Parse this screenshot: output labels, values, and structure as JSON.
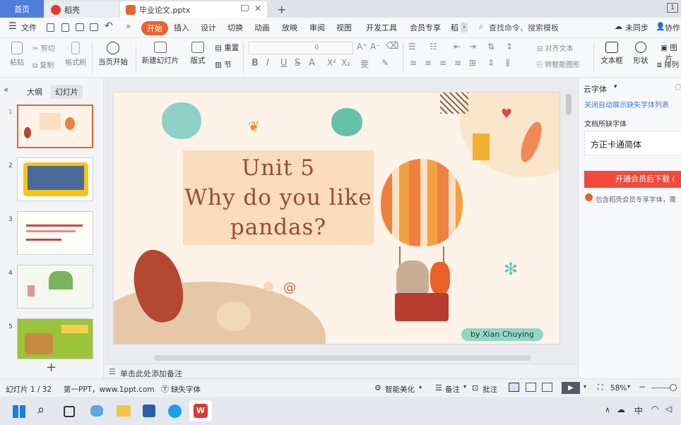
{
  "tabs": {
    "home": "首页",
    "docer": "稻壳",
    "file": "毕业论文.pptx",
    "add": "+"
  },
  "menu": {
    "file": "文件",
    "items": [
      "开始",
      "插入",
      "设计",
      "切换",
      "动画",
      "放映",
      "审阅",
      "视图",
      "开发工具",
      "会员专享",
      "稻"
    ],
    "search": "查找命令、搜索模板",
    "sync": "未同步",
    "collab": "协作"
  },
  "ribbon": {
    "paste": "粘贴",
    "cut": "剪切",
    "copy": "复制",
    "format_painter": "格式刷",
    "from_start": "当页开始",
    "new_slide": "新建幻灯片",
    "layout": "版式",
    "reset": "重置",
    "section": "节",
    "font_size": "0",
    "align_text": "对齐文本",
    "smart_art": "转智能图形",
    "textbox": "文本框",
    "shape": "形状",
    "picture": "图片",
    "arrange": "排列"
  },
  "leftpanel": {
    "outline_tab": "大纲",
    "slides_tab": "幻灯片",
    "numbers": [
      "1",
      "2",
      "3",
      "4",
      "5"
    ],
    "add": "+"
  },
  "slide": {
    "title_line1": "Unit 5",
    "title_line2": "Why do you like",
    "title_line3": "pandas?",
    "byline": "by Xian Chuying"
  },
  "notes": {
    "placeholder": "单击此处添加备注"
  },
  "rightpanel": {
    "cloud_font": "云字体",
    "close_link": "关闭自动展示缺失字体列表",
    "missing_label": "文档所缺字体",
    "missing_font": "方正卡通简体",
    "download_button": "开通会员后下载 (",
    "member_note": "包含稻壳会员专享字体，需"
  },
  "status": {
    "slide_count": "幻灯片 1 / 32",
    "theme": "第一PPT，www.1ppt.com",
    "missing_font": "缺失字体",
    "beautify": "智能美化",
    "notes": "备注",
    "comments": "批注",
    "zoom": "58%"
  },
  "taskbar": {
    "ime": "中"
  },
  "colors": {
    "accent": "#e8632a",
    "home_tab": "#4e7ddb",
    "download_button": "#f04a3a",
    "link": "#3a7bd5"
  }
}
